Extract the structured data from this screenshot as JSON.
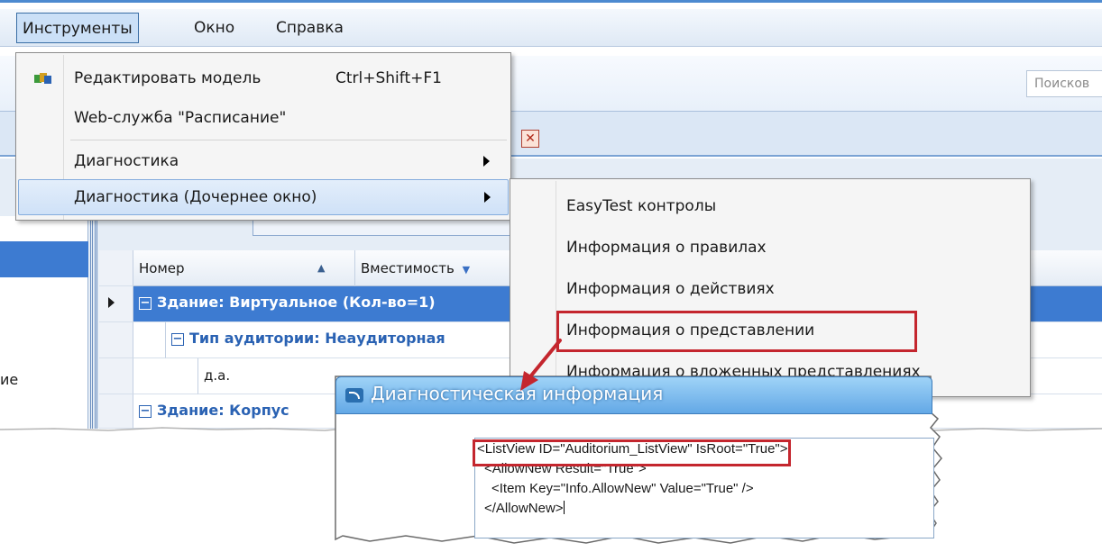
{
  "menubar": {
    "items": [
      "Инструменты",
      "Окно",
      "Справка"
    ]
  },
  "toolbar": {
    "search_placeholder": "Поисков"
  },
  "dropdown": {
    "items": [
      {
        "label": "Редактировать модель",
        "shortcut": "Ctrl+Shift+F1",
        "icon": "model-editor-icon"
      },
      {
        "label": "Web-служба \"Расписание\""
      },
      {
        "label": "Диагностика",
        "has_submenu": true
      },
      {
        "label": "Диагностика (Дочернее окно)",
        "has_submenu": true,
        "highlighted": true
      }
    ]
  },
  "submenu": {
    "items": [
      "EasyTest контролы",
      "Информация о правилах",
      "Информация о действиях",
      "Информация о представлении",
      "Информация о вложенных представлениях"
    ],
    "marked_item_index": 3
  },
  "grid": {
    "columns": [
      "Номер",
      "Вместимость"
    ],
    "rows": [
      {
        "type": "group",
        "text": "Здание: Виртуальное (Кол-во=1)",
        "selected": true
      },
      {
        "type": "group",
        "text": "Тип аудитории: Неаудиторная"
      },
      {
        "type": "data",
        "text": "д.а."
      },
      {
        "type": "group",
        "text": "Здание: Корпус"
      }
    ]
  },
  "left_panel": {
    "partial_text": "ие"
  },
  "diagnostic_window": {
    "title": "Диагностическая информация",
    "xml_lines": [
      "<ListView ID=\"Auditorium_ListView\" IsRoot=\"True\">",
      "  <AllowNew Result=\"True\">",
      "    <Item Key=\"Info.AllowNew\" Value=\"True\" />",
      "  </AllowNew>"
    ]
  },
  "colors": {
    "accent": "#3d7bd1",
    "highlight_box": "#c4262e",
    "title_bar": "#63a8e6"
  }
}
